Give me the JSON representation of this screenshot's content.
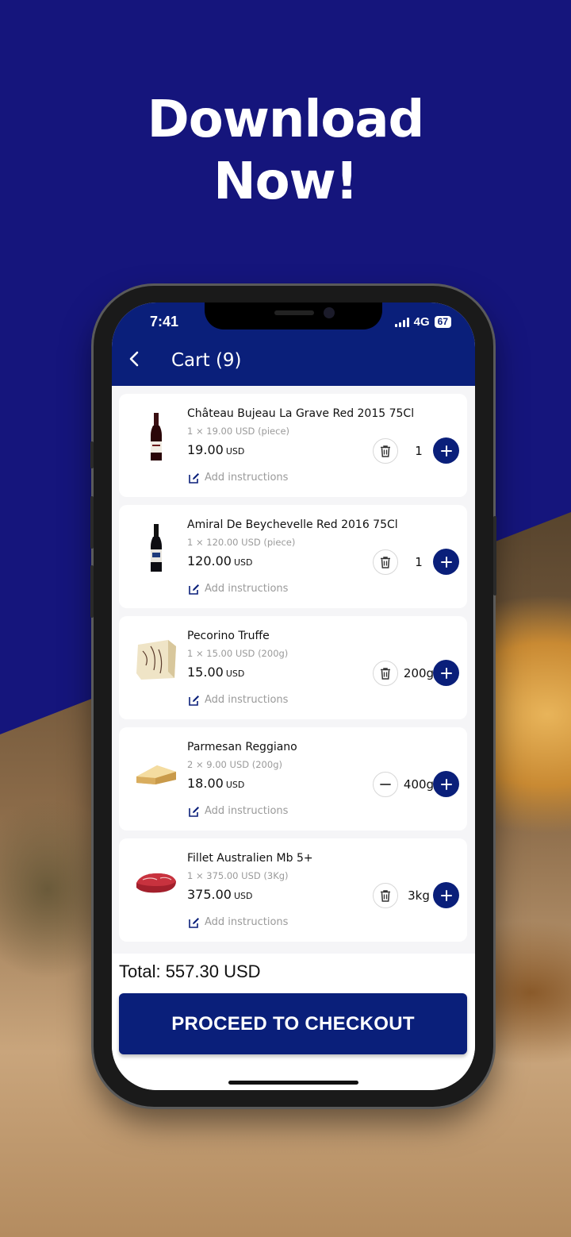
{
  "promo": {
    "headline_line1": "Download",
    "headline_line2": "Now!"
  },
  "status_bar": {
    "time": "7:41",
    "network": "4G",
    "battery": "67"
  },
  "app_bar": {
    "title": "Cart (9)"
  },
  "cart_items": [
    {
      "name": "Château Bujeau La Grave Red 2015 75Cl",
      "unit_line": "1 × 19.00 USD (piece)",
      "price": "19.00",
      "currency": "USD",
      "quantity": "1",
      "left_action": "trash-icon",
      "instructions": "Add instructions",
      "image": "red-wine-bottle"
    },
    {
      "name": "Amiral De Beychevelle Red 2016 75Cl",
      "unit_line": "1 × 120.00 USD (piece)",
      "price": "120.00",
      "currency": "USD",
      "quantity": "1",
      "left_action": "trash-icon",
      "instructions": "Add instructions",
      "image": "wine-bottle-blue-label"
    },
    {
      "name": "Pecorino Truffe",
      "unit_line": "1 × 15.00 USD (200g)",
      "price": "15.00",
      "currency": "USD",
      "quantity": "200g",
      "left_action": "trash-icon",
      "instructions": "Add instructions",
      "image": "truffle-cheese"
    },
    {
      "name": "Parmesan Reggiano",
      "unit_line": "2 × 9.00 USD (200g)",
      "price": "18.00",
      "currency": "USD",
      "quantity": "400g",
      "left_action": "minus-icon",
      "instructions": "Add instructions",
      "image": "parmesan-cheese"
    },
    {
      "name": "Fillet Australien Mb 5+",
      "unit_line": "1 × 375.00 USD (3Kg)",
      "price": "375.00",
      "currency": "USD",
      "quantity": "3kg",
      "left_action": "trash-icon",
      "instructions": "Add instructions",
      "image": "raw-beef-steak"
    }
  ],
  "footer": {
    "total": "Total: 557.30 USD",
    "checkout_label": "PROCEED TO CHECKOUT"
  },
  "colors": {
    "brand_navy": "#0a1f7a",
    "promo_background": "#15157c"
  }
}
